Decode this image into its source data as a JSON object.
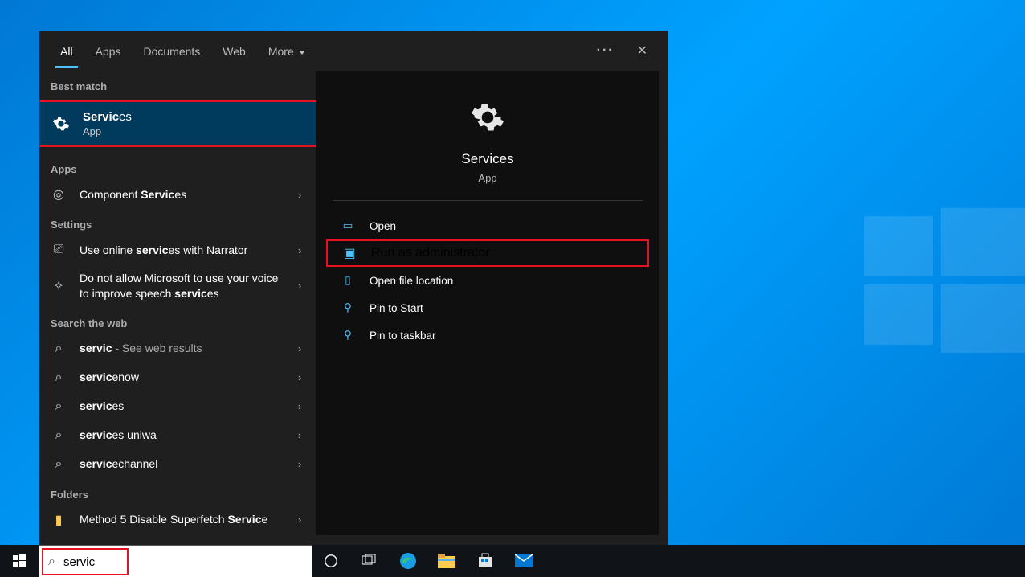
{
  "tabs": {
    "all": "All",
    "apps": "Apps",
    "documents": "Documents",
    "web": "Web",
    "more": "More"
  },
  "sections": {
    "best_match": "Best match",
    "apps": "Apps",
    "settings": "Settings",
    "web": "Search the web",
    "folders": "Folders"
  },
  "best_match": {
    "title_bold": "Servic",
    "title_rest": "es",
    "subtitle": "App"
  },
  "apps_results": [
    {
      "prefix": "Component ",
      "bold": "Servic",
      "suffix": "es"
    }
  ],
  "settings_results": [
    {
      "prefix": "Use online ",
      "bold": "servic",
      "suffix": "es with Narrator"
    },
    {
      "prefix": "Do not allow Microsoft to use your voice to improve speech ",
      "bold": "servic",
      "suffix": "es"
    }
  ],
  "web_results": [
    {
      "bold": "servic",
      "suffix": "",
      "extra": " - See web results"
    },
    {
      "bold": "servic",
      "suffix": "enow"
    },
    {
      "bold": "servic",
      "suffix": "es"
    },
    {
      "bold": "servic",
      "suffix": "es uniwa"
    },
    {
      "bold": "servic",
      "suffix": "echannel"
    }
  ],
  "folders_results": [
    {
      "prefix": "Method 5 Disable Superfetch ",
      "bold": "Servic",
      "suffix": "e"
    }
  ],
  "detail": {
    "title": "Services",
    "subtitle": "App",
    "actions": {
      "open": "Open",
      "run_admin": "Run as administrator",
      "open_location": "Open file location",
      "pin_start": "Pin to Start",
      "pin_taskbar": "Pin to taskbar"
    }
  },
  "search": {
    "value": "servic"
  }
}
